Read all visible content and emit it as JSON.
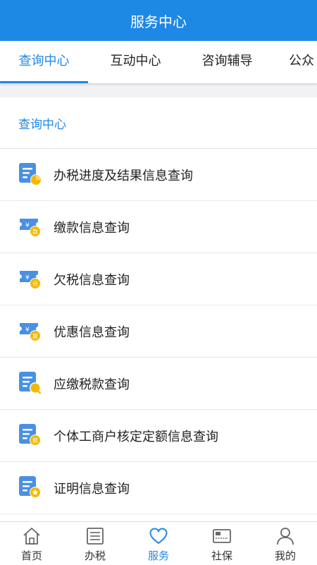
{
  "header": {
    "title": "服务中心"
  },
  "tabs": [
    {
      "label": "查询中心",
      "active": true
    },
    {
      "label": "互动中心",
      "active": false
    },
    {
      "label": "咨询辅导",
      "active": false
    },
    {
      "label": "公众",
      "active": false
    }
  ],
  "section": {
    "title": "查询中心"
  },
  "list": [
    {
      "label": "办税进度及结果信息查询",
      "icon": "document-progress-icon",
      "badge": ""
    },
    {
      "label": "缴款信息查询",
      "icon": "ticket-payment-icon",
      "badge": "款"
    },
    {
      "label": "欠税信息查询",
      "icon": "ticket-overdue-icon",
      "badge": "待"
    },
    {
      "label": "优惠信息查询",
      "icon": "ticket-discount-icon",
      "badge": "惠"
    },
    {
      "label": "应缴税款查询",
      "icon": "document-search-icon",
      "badge": ""
    },
    {
      "label": "个体工商户核定定额信息查询",
      "icon": "document-quota-icon",
      "badge": "额"
    },
    {
      "label": "证明信息查询",
      "icon": "document-certificate-icon",
      "badge": ""
    }
  ],
  "bottom_nav": [
    {
      "label": "首页",
      "icon": "home-icon",
      "active": false
    },
    {
      "label": "办税",
      "icon": "list-icon",
      "active": false
    },
    {
      "label": "服务",
      "icon": "heart-icon",
      "active": true
    },
    {
      "label": "社保",
      "icon": "card-icon",
      "active": false
    },
    {
      "label": "我的",
      "icon": "user-icon",
      "active": false
    }
  ],
  "colors": {
    "primary": "#1e88e5",
    "icon_blue": "#4a90e2",
    "badge_yellow": "#f5b800",
    "background": "#f2f2f4"
  }
}
